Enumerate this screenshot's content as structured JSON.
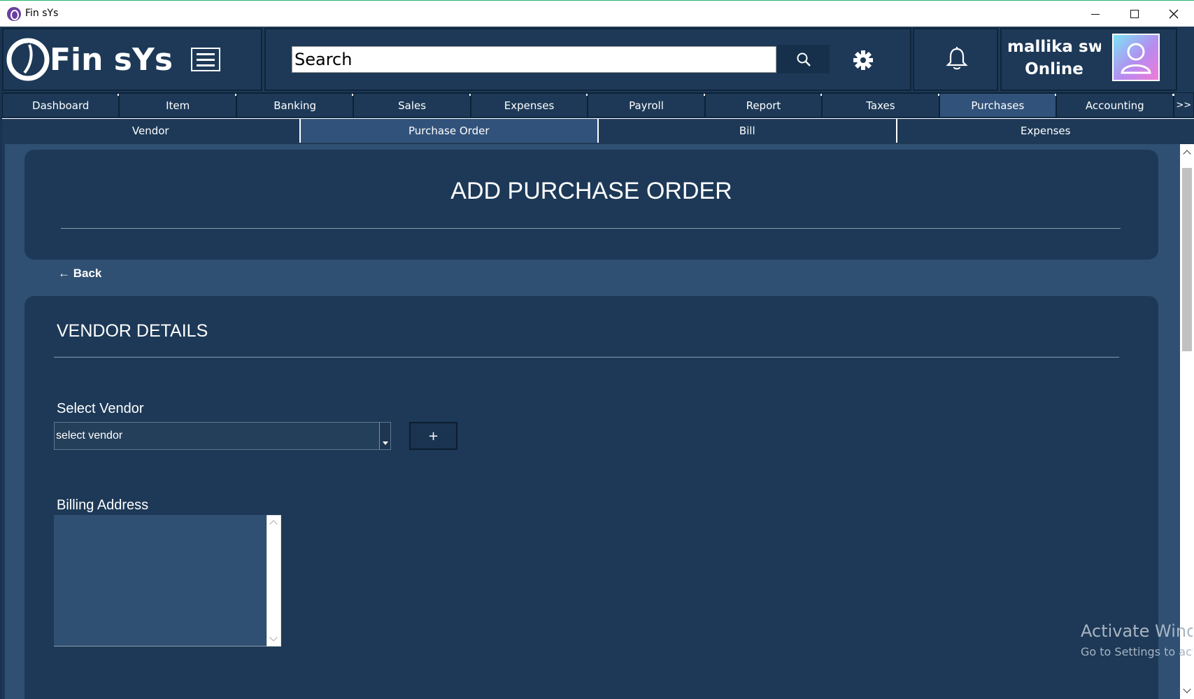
{
  "window": {
    "title": "Fin sYs",
    "minimize_icon": "minimize-icon",
    "maximize_icon": "maximize-icon",
    "close_icon": "close-icon"
  },
  "header": {
    "logo_text": "Fin sYs",
    "search_placeholder": "Search",
    "search_icon": "search-icon",
    "settings_icon": "gear-icon",
    "notification_icon": "bell-icon",
    "user_name": "mallika sweets",
    "user_status": "Online"
  },
  "tabs": [
    {
      "label": "Dashboard"
    },
    {
      "label": "Item"
    },
    {
      "label": "Banking"
    },
    {
      "label": "Sales"
    },
    {
      "label": "Expenses"
    },
    {
      "label": "Payroll"
    },
    {
      "label": "Report"
    },
    {
      "label": "Taxes"
    },
    {
      "label": "Purchases"
    },
    {
      "label": "Accounting"
    }
  ],
  "tabs_more": ">>",
  "active_tab": "Purchases",
  "subtabs": [
    {
      "label": "Vendor"
    },
    {
      "label": "Purchase Order"
    },
    {
      "label": "Bill"
    },
    {
      "label": "Expenses"
    }
  ],
  "active_subtab": "Purchase Order",
  "page": {
    "title": "ADD PURCHASE ORDER",
    "back_label": "← Back",
    "section_title": "VENDOR DETAILS",
    "select_vendor_label": "Select Vendor",
    "select_vendor_value": "select vendor",
    "add_vendor_label": "+",
    "billing_address_label": "Billing Address",
    "billing_address_value": ""
  },
  "watermark": {
    "line1": "Activate Windows",
    "line2": "Go to Settings to activate Windows."
  },
  "colors": {
    "background": "#1d3957",
    "content_bg": "#2f5072",
    "active_tab": "#31527a"
  }
}
